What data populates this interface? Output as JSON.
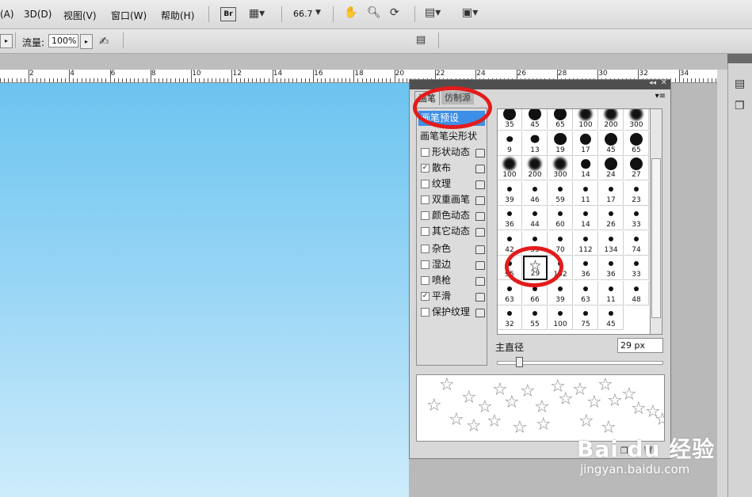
{
  "menubar": {
    "items": [
      "(A)",
      "3D(D)",
      "视图(V)",
      "窗口(W)",
      "帮助(H)"
    ],
    "br_label": "Br",
    "zoom": "66.7"
  },
  "options": {
    "flow_label": "流量:",
    "flow_value": "100%"
  },
  "ruler": {
    "labels": [
      "2",
      "4",
      "6",
      "8",
      "10",
      "12",
      "14",
      "16",
      "18",
      "20",
      "22",
      "24",
      "26",
      "28",
      "30",
      "32",
      "34",
      "36"
    ]
  },
  "panel": {
    "tabs": [
      "画笔",
      "仿制源"
    ],
    "preset_label": "画笔预设",
    "tip_shape_label": "画笔笔尖形状",
    "options": [
      {
        "label": "形状动态",
        "checked": false
      },
      {
        "label": "散布",
        "checked": true
      },
      {
        "label": "纹理",
        "checked": false
      },
      {
        "label": "双重画笔",
        "checked": false
      },
      {
        "label": "颜色动态",
        "checked": false
      },
      {
        "label": "其它动态",
        "checked": false
      },
      {
        "label": "杂色",
        "checked": false
      },
      {
        "label": "湿边",
        "checked": false
      },
      {
        "label": "喷枪",
        "checked": false
      },
      {
        "label": "平滑",
        "checked": true
      },
      {
        "label": "保护纹理",
        "checked": false
      }
    ],
    "brushes": [
      "35",
      "45",
      "65",
      "100",
      "200",
      "300",
      "9",
      "13",
      "19",
      "17",
      "45",
      "65",
      "100",
      "200",
      "300",
      "14",
      "24",
      "27",
      "39",
      "46",
      "59",
      "11",
      "17",
      "23",
      "36",
      "44",
      "60",
      "14",
      "26",
      "33",
      "42",
      "55",
      "70",
      "112",
      "134",
      "74",
      "95",
      "29",
      "192",
      "36",
      "36",
      "33",
      "63",
      "66",
      "39",
      "63",
      "11",
      "48",
      "32",
      "55",
      "100",
      "75",
      "45"
    ],
    "selected_brush": "29",
    "diameter_label": "主直径",
    "diameter_value": "29 px"
  },
  "watermark": {
    "brand": "Bai du 经验",
    "url": "jingyan.baidu.com"
  }
}
